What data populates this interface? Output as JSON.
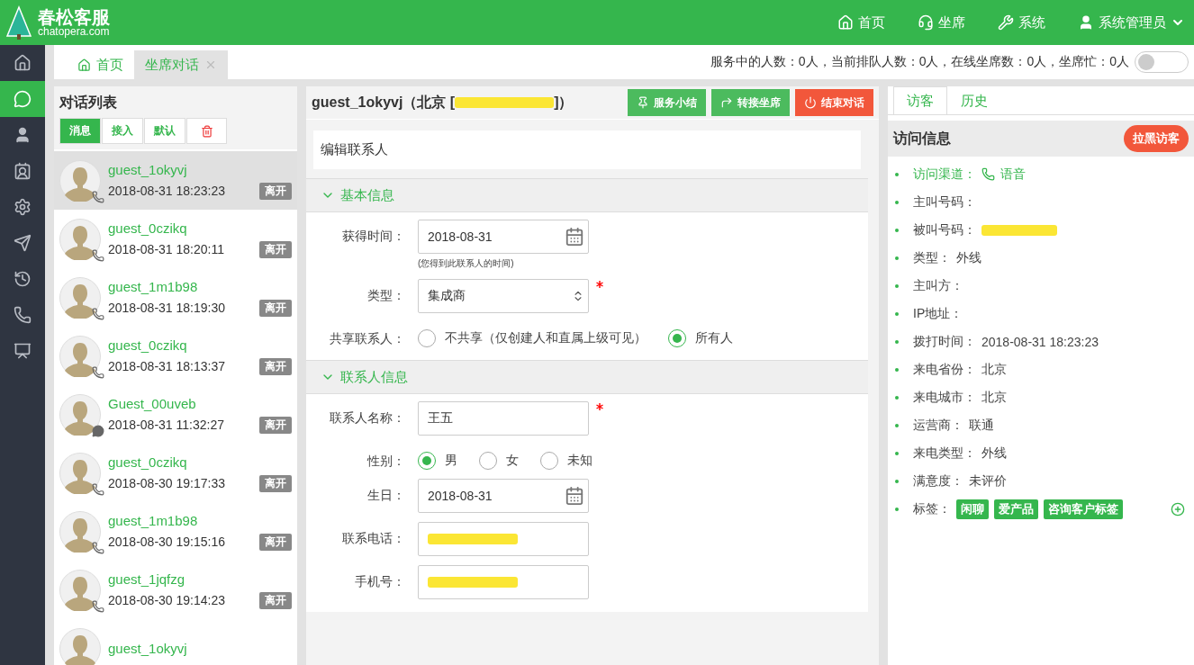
{
  "brand": {
    "name": "春松客服",
    "domain": "chatopera.com"
  },
  "top_nav": [
    {
      "kind": "home",
      "label": "首页"
    },
    {
      "kind": "agent",
      "label": "坐席"
    },
    {
      "kind": "system",
      "label": "系统"
    },
    {
      "kind": "user",
      "label": "系统管理员"
    }
  ],
  "side_nav": [
    {
      "kind": "home",
      "selected": false
    },
    {
      "kind": "chat",
      "selected": true
    },
    {
      "kind": "user",
      "selected": false
    },
    {
      "kind": "contact",
      "selected": false
    },
    {
      "kind": "gear",
      "selected": false
    },
    {
      "kind": "send",
      "selected": false
    },
    {
      "kind": "history",
      "selected": false
    },
    {
      "kind": "phone",
      "selected": false
    },
    {
      "kind": "chart",
      "selected": false
    }
  ],
  "page_tabs": [
    {
      "label": "首页",
      "kind": "home",
      "selected": false
    },
    {
      "label": "坐席对话",
      "kind": "closable",
      "selected": true
    }
  ],
  "status_text": "服务中的人数：0人，当前排队人数：0人，在线坐席数：0人，坐席忙：0人",
  "busy_switch": {
    "on": false
  },
  "conversation_list": {
    "title": "对话列表",
    "filters": [
      {
        "kind": "text",
        "label": "消息",
        "selected": true
      },
      {
        "kind": "text",
        "label": "接入",
        "selected": false
      },
      {
        "kind": "text",
        "label": "默认",
        "selected": false
      },
      {
        "kind": "trash",
        "selected": false
      }
    ],
    "items": [
      {
        "name": "guest_1okyvj",
        "time": "2018-08-31 18:23:23",
        "status": "离开",
        "kind": "phone",
        "selected": true
      },
      {
        "name": "guest_0czikq",
        "time": "2018-08-31 18:20:11",
        "status": "离开",
        "kind": "phone",
        "selected": false
      },
      {
        "name": "guest_1m1b98",
        "time": "2018-08-31 18:19:30",
        "status": "离开",
        "kind": "phone",
        "selected": false
      },
      {
        "name": "guest_0czikq",
        "time": "2018-08-31 18:13:37",
        "status": "离开",
        "kind": "phone",
        "selected": false
      },
      {
        "name": "Guest_00uveb",
        "time": "2018-08-31 11:32:27",
        "status": "离开",
        "kind": "chat",
        "selected": false
      },
      {
        "name": "guest_0czikq",
        "time": "2018-08-30 19:17:33",
        "status": "离开",
        "kind": "phone",
        "selected": false
      },
      {
        "name": "guest_1m1b98",
        "time": "2018-08-30 19:15:16",
        "status": "离开",
        "kind": "phone",
        "selected": false
      },
      {
        "name": "guest_1jqfzg",
        "time": "2018-08-30 19:14:23",
        "status": "离开",
        "kind": "phone",
        "selected": false
      },
      {
        "name": "guest_1okyvj",
        "selected": false
      }
    ]
  },
  "conversation": {
    "title_start": "guest_1okyvj（北京 [",
    "title_end": "]）",
    "actions": [
      {
        "kind": "summary",
        "label": "服务小结"
      },
      {
        "kind": "transfer",
        "label": "转接坐席"
      },
      {
        "kind": "end",
        "label": "结束对话"
      }
    ],
    "form_title": "编辑联系人",
    "sections": [
      {
        "title": "基本信息",
        "expanded": true,
        "fields": [
          {
            "kind": "date",
            "label": "获得时间：",
            "value": "2018-08-31",
            "hint": "(您得到此联系人的时间)"
          },
          {
            "kind": "select",
            "label": "类型：",
            "value": "集成商",
            "required": true
          },
          {
            "kind": "radio",
            "label": "共享联系人：",
            "options": [
              {
                "label": "不共享（仅创建人和直属上级可见）",
                "selected": false
              },
              {
                "label": "所有人",
                "selected": true
              }
            ]
          }
        ]
      },
      {
        "title": "联系人信息",
        "expanded": true,
        "fields": [
          {
            "kind": "text",
            "label": "联系人名称：",
            "value": "王五",
            "required": true
          },
          {
            "kind": "radio",
            "label": "性别：",
            "options": [
              {
                "label": "男",
                "selected": true
              },
              {
                "label": "女",
                "selected": false
              },
              {
                "label": "未知",
                "selected": false
              }
            ]
          },
          {
            "kind": "date",
            "label": "生日：",
            "value": "2018-08-31"
          },
          {
            "kind": "redacted",
            "label": "联系电话："
          },
          {
            "kind": "redacted",
            "label": "手机号："
          }
        ]
      }
    ]
  },
  "visitor_panel": {
    "tabs": [
      {
        "label": "访客",
        "selected": true
      },
      {
        "label": "历史",
        "selected": false
      }
    ],
    "title": "访问信息",
    "block_button": "拉黑访客",
    "items": [
      {
        "kind": "channel",
        "label": "访问渠道：",
        "value": "语音"
      },
      {
        "kind": "text",
        "label": "主叫号码："
      },
      {
        "kind": "redacted",
        "label": "被叫号码："
      },
      {
        "kind": "text",
        "label": "类型：",
        "value": "外线"
      },
      {
        "kind": "text",
        "label": "主叫方："
      },
      {
        "kind": "text",
        "label": "IP地址："
      },
      {
        "kind": "text",
        "label": "拨打时间：",
        "value": "2018-08-31 18:23:23"
      },
      {
        "kind": "text",
        "label": "来电省份：",
        "value": "北京"
      },
      {
        "kind": "text",
        "label": "来电城市：",
        "value": "北京"
      },
      {
        "kind": "text",
        "label": "运营商：",
        "value": "联通"
      },
      {
        "kind": "text",
        "label": "来电类型：",
        "value": "外线"
      },
      {
        "kind": "text",
        "label": "满意度：",
        "value": "未评价"
      },
      {
        "kind": "tags",
        "label": "标签：",
        "tags": [
          "闲聊",
          "爱产品",
          "咨询客户标签"
        ]
      }
    ]
  }
}
